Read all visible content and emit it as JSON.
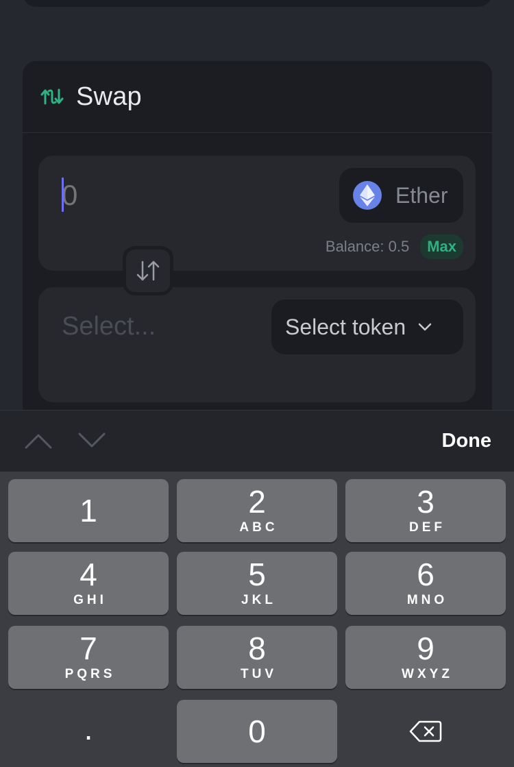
{
  "swap": {
    "title": "Swap",
    "from": {
      "amount_value": "",
      "amount_placeholder": "0",
      "token": "Ether",
      "balance": "Balance: 0.5",
      "max_label": "Max"
    },
    "to": {
      "amount_placeholder": "Select...",
      "select_token_label": "Select token"
    }
  },
  "keyboard_toolbar": {
    "done_label": "Done"
  },
  "keypad": {
    "k1": {
      "num": "1",
      "letters": ""
    },
    "k2": {
      "num": "2",
      "letters": "ABC"
    },
    "k3": {
      "num": "3",
      "letters": "DEF"
    },
    "k4": {
      "num": "4",
      "letters": "GHI"
    },
    "k5": {
      "num": "5",
      "letters": "JKL"
    },
    "k6": {
      "num": "6",
      "letters": "MNO"
    },
    "k7": {
      "num": "7",
      "letters": "PQRS"
    },
    "k8": {
      "num": "8",
      "letters": "TUV"
    },
    "k9": {
      "num": "9",
      "letters": "WXYZ"
    },
    "kdot": ".",
    "k0": "0"
  },
  "colors": {
    "accent_green": "#2fb283",
    "caret": "#6b6ff0",
    "eth_logo": "#6783e8"
  }
}
